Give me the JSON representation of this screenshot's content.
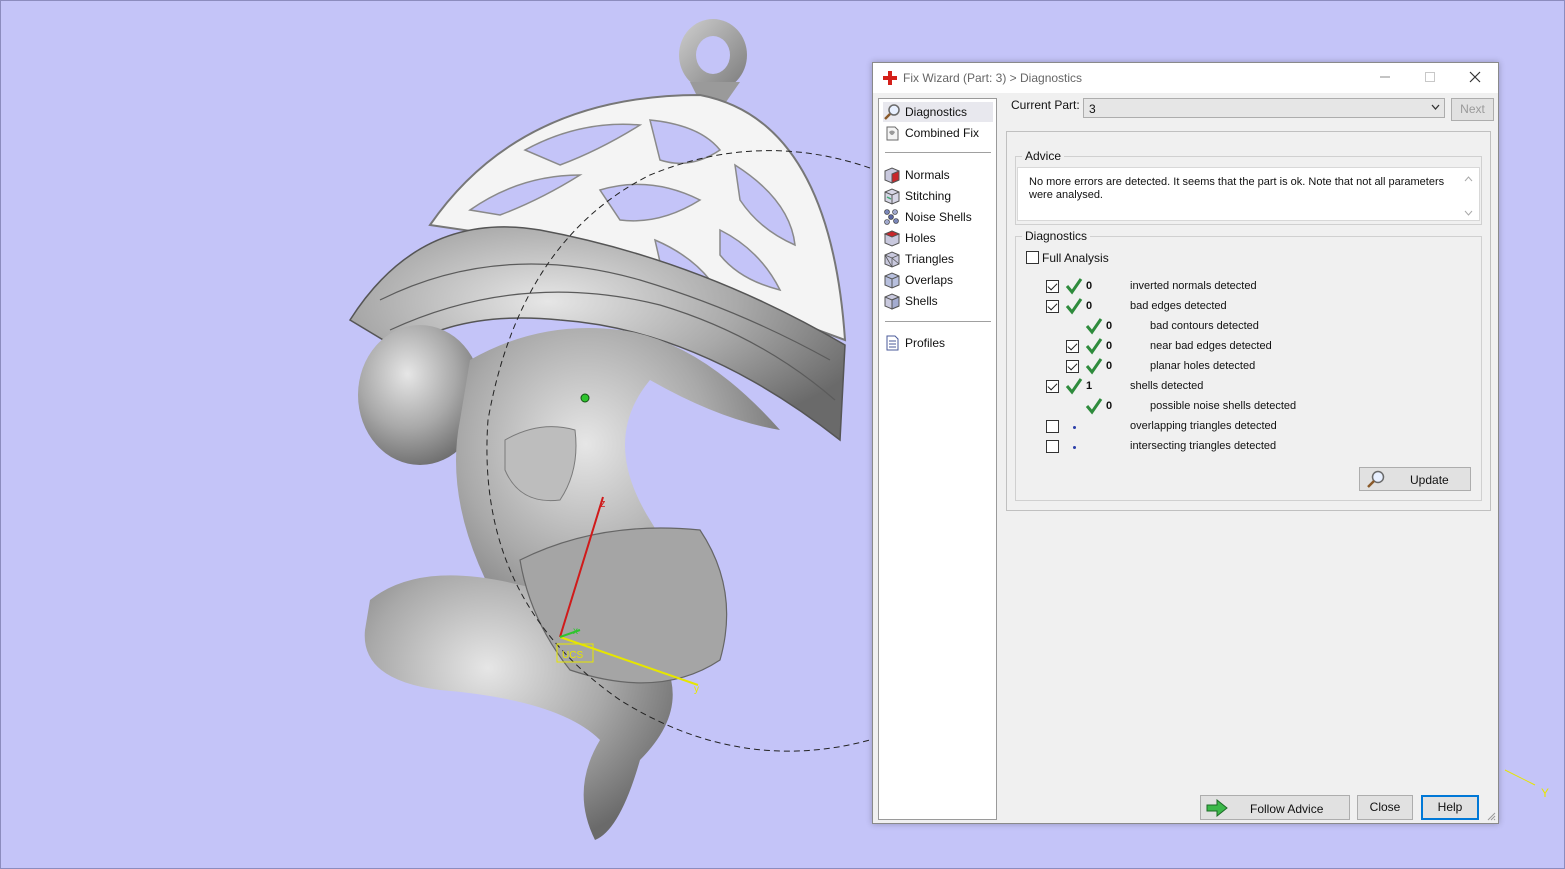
{
  "colors": {
    "viewport_bg": "#c4c4f8",
    "check_green": "#2e8b3c",
    "axis_red": "#d01a1a",
    "axis_yellow": "#e6e600"
  },
  "viewport": {
    "axis_z": "z",
    "axis_x": "x",
    "axis_y": "y",
    "corner_axis": "Y",
    "ucs_label": "UCS"
  },
  "dialog": {
    "title": "Fix Wizard (Part: 3) > Diagnostics",
    "title_icon": "red-cross-icon",
    "nav": {
      "top": [
        {
          "label": "Diagnostics",
          "icon": "magnifier-icon"
        },
        {
          "label": "Combined Fix",
          "icon": "combined-fix-icon"
        }
      ],
      "tools": [
        {
          "label": "Normals",
          "icon": "normals-cube-icon"
        },
        {
          "label": "Stitching",
          "icon": "stitching-cube-icon"
        },
        {
          "label": "Noise Shells",
          "icon": "noise-shells-icon"
        },
        {
          "label": "Holes",
          "icon": "holes-cube-icon"
        },
        {
          "label": "Triangles",
          "icon": "triangles-cube-icon"
        },
        {
          "label": "Overlaps",
          "icon": "overlaps-cube-icon"
        },
        {
          "label": "Shells",
          "icon": "shells-cube-icon"
        }
      ],
      "bottom": [
        {
          "label": "Profiles",
          "icon": "profiles-doc-icon"
        }
      ]
    },
    "current_part_label": "Current Part:",
    "current_part_value": "3",
    "next_label": "Next",
    "advice": {
      "title": "Advice",
      "text": "No more errors are detected. It seems that the part is ok. Note that not all parameters were analysed."
    },
    "diagnostics": {
      "title": "Diagnostics",
      "full_analysis_label": "Full Analysis",
      "full_analysis_checked": false,
      "rows": [
        {
          "checked": true,
          "count": "0",
          "text": "inverted normals detected",
          "status": "ok"
        },
        {
          "checked": true,
          "count": "0",
          "text": "bad edges detected",
          "status": "ok"
        },
        {
          "checked": null,
          "count": "0",
          "text": "bad contours detected",
          "status": "ok"
        },
        {
          "checked": true,
          "count": "0",
          "text": "near bad edges detected",
          "status": "ok"
        },
        {
          "checked": true,
          "count": "0",
          "text": "planar holes detected",
          "status": "ok"
        },
        {
          "checked": true,
          "count": "1",
          "text": "shells detected",
          "status": "ok"
        },
        {
          "checked": null,
          "count": "0",
          "text": "possible noise shells detected",
          "status": "ok"
        },
        {
          "checked": false,
          "count": "",
          "text": "overlapping triangles detected",
          "status": "not-analysed"
        },
        {
          "checked": false,
          "count": "",
          "text": "intersecting triangles detected",
          "status": "not-analysed"
        }
      ],
      "update_label": "Update"
    },
    "footer": {
      "follow_advice_label": "Follow Advice",
      "close_label": "Close",
      "help_label": "Help"
    }
  }
}
